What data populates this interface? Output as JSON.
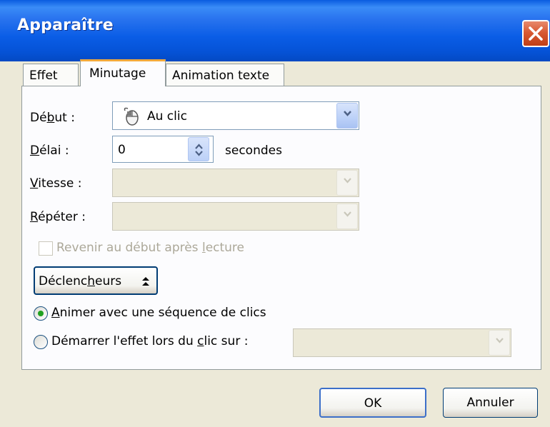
{
  "window": {
    "title": "Apparaître"
  },
  "tabs": [
    {
      "label": "Effet",
      "active": false
    },
    {
      "label": "Minutage",
      "active": true
    },
    {
      "label": "Animation texte",
      "active": false
    }
  ],
  "form": {
    "debut": {
      "label_pre": "Dé",
      "label_u": "b",
      "label_post": "ut :",
      "value": "Au clic"
    },
    "delai": {
      "label_u": "D",
      "label_post": "élai :",
      "value": "0",
      "unit": "secondes"
    },
    "vitesse": {
      "label_u": "V",
      "label_post": "itesse :",
      "value": ""
    },
    "repeter": {
      "label_u": "R",
      "label_post": "épéter :",
      "value": ""
    },
    "revenir": {
      "label_pre": "Revenir au début après ",
      "label_u": "l",
      "label_post": "ecture",
      "checked": false
    }
  },
  "triggers": {
    "button_pre": "Déclenc",
    "button_u": "h",
    "button_post": "eurs",
    "option1": {
      "label_u": "A",
      "label_post": "nimer avec une séquence de clics",
      "selected": true
    },
    "option2": {
      "label_pre": "Démarrer l'effet lors du ",
      "label_u": "c",
      "label_post": "lic sur :",
      "selected": false,
      "value": ""
    }
  },
  "footer": {
    "ok": "OK",
    "cancel": "Annuler"
  },
  "colors": {
    "titlebar": "#0a5de6",
    "close": "#d85a33",
    "tab_accent": "#f1a93c",
    "radio_dot": "#21a121"
  },
  "icons": {
    "close": "close-icon",
    "mouse": "mouse-icon",
    "dropdown": "chevron-down-icon",
    "spin": "spin-arrows-icon"
  }
}
